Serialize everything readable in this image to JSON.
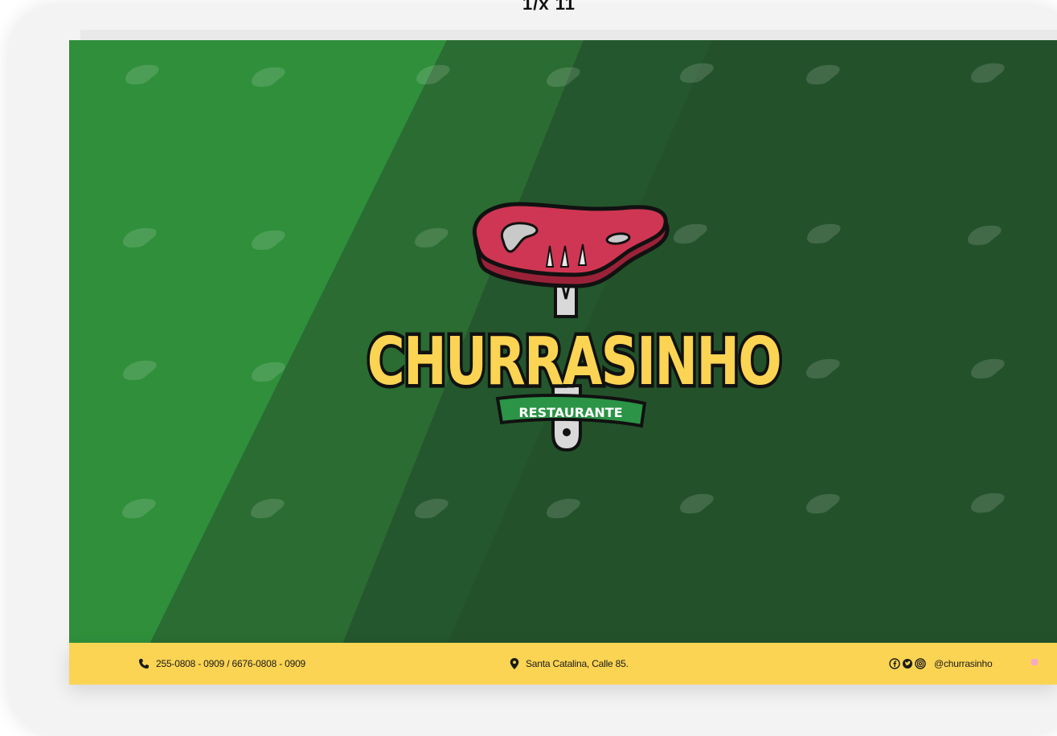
{
  "top_fragment": "1/x 11",
  "brand": {
    "name": "CHURRASINHO",
    "tagline": "RESTAURANTE"
  },
  "footer": {
    "phone": "255-0808 - 0909 / 6676-0808 - 0909",
    "address": "Santa Catalina, Calle 85.",
    "social_handle": "@churrasinho"
  },
  "icons": {
    "phone": "phone-icon",
    "location": "location-pin-icon",
    "facebook": "facebook-icon",
    "twitter": "twitter-icon",
    "instagram": "instagram-icon"
  },
  "colors": {
    "dark_green": "#23522a",
    "light_green": "#2f8f3b",
    "mid_green": "#2a6c31",
    "yellow": "#fbd453",
    "meat_red": "#c8334f",
    "badge_green": "#2b9446"
  }
}
